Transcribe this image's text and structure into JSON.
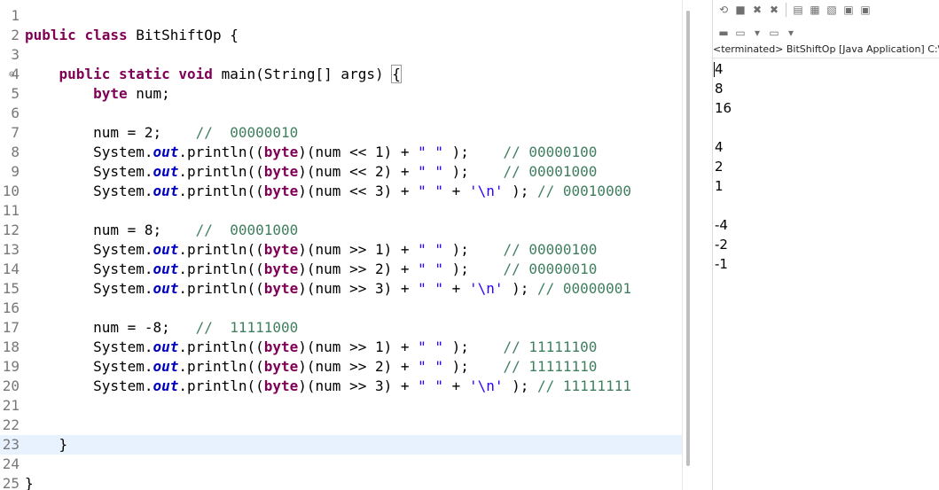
{
  "editor": {
    "lines": [
      {
        "n": "1",
        "code": []
      },
      {
        "n": "2",
        "code": [
          {
            "c": "kw",
            "t": "public"
          },
          {
            "t": " "
          },
          {
            "c": "kw",
            "t": "class"
          },
          {
            "t": " BitShiftOp {"
          }
        ]
      },
      {
        "n": "3",
        "code": []
      },
      {
        "n": "4",
        "fold": "⊖",
        "code": [
          {
            "t": "    "
          },
          {
            "c": "kw",
            "t": "public"
          },
          {
            "t": " "
          },
          {
            "c": "kw",
            "t": "static"
          },
          {
            "t": " "
          },
          {
            "c": "kw",
            "t": "void"
          },
          {
            "t": " main(String[] args) "
          },
          {
            "c": "bracket",
            "t": "{"
          }
        ]
      },
      {
        "n": "5",
        "code": [
          {
            "t": "        "
          },
          {
            "c": "kw",
            "t": "byte"
          },
          {
            "t": " num;"
          }
        ]
      },
      {
        "n": "6",
        "code": []
      },
      {
        "n": "7",
        "code": [
          {
            "t": "        num = 2;    "
          },
          {
            "c": "cm",
            "t": "//  00000010"
          }
        ]
      },
      {
        "n": "8",
        "code": [
          {
            "t": "        System."
          },
          {
            "c": "fld",
            "t": "out"
          },
          {
            "t": ".println(("
          },
          {
            "c": "kw",
            "t": "byte"
          },
          {
            "t": ")(num << 1) + "
          },
          {
            "c": "str",
            "t": "\" \""
          },
          {
            "t": " );    "
          },
          {
            "c": "cm",
            "t": "// 00000100"
          }
        ]
      },
      {
        "n": "9",
        "code": [
          {
            "t": "        System."
          },
          {
            "c": "fld",
            "t": "out"
          },
          {
            "t": ".println(("
          },
          {
            "c": "kw",
            "t": "byte"
          },
          {
            "t": ")(num << 2) + "
          },
          {
            "c": "str",
            "t": "\" \""
          },
          {
            "t": " );    "
          },
          {
            "c": "cm",
            "t": "// 00001000"
          }
        ]
      },
      {
        "n": "10",
        "code": [
          {
            "t": "        System."
          },
          {
            "c": "fld",
            "t": "out"
          },
          {
            "t": ".println(("
          },
          {
            "c": "kw",
            "t": "byte"
          },
          {
            "t": ")(num << 3) + "
          },
          {
            "c": "str",
            "t": "\" \""
          },
          {
            "t": " + "
          },
          {
            "c": "str",
            "t": "'\\n'"
          },
          {
            "t": " ); "
          },
          {
            "c": "cm",
            "t": "// 00010000"
          }
        ]
      },
      {
        "n": "11",
        "code": []
      },
      {
        "n": "12",
        "code": [
          {
            "t": "        num = 8;    "
          },
          {
            "c": "cm",
            "t": "//  00001000"
          }
        ]
      },
      {
        "n": "13",
        "code": [
          {
            "t": "        System."
          },
          {
            "c": "fld",
            "t": "out"
          },
          {
            "t": ".println(("
          },
          {
            "c": "kw",
            "t": "byte"
          },
          {
            "t": ")(num >> 1) + "
          },
          {
            "c": "str",
            "t": "\" \""
          },
          {
            "t": " );    "
          },
          {
            "c": "cm",
            "t": "// 00000100"
          }
        ]
      },
      {
        "n": "14",
        "code": [
          {
            "t": "        System."
          },
          {
            "c": "fld",
            "t": "out"
          },
          {
            "t": ".println(("
          },
          {
            "c": "kw",
            "t": "byte"
          },
          {
            "t": ")(num >> 2) + "
          },
          {
            "c": "str",
            "t": "\" \""
          },
          {
            "t": " );    "
          },
          {
            "c": "cm",
            "t": "// 00000010"
          }
        ]
      },
      {
        "n": "15",
        "code": [
          {
            "t": "        System."
          },
          {
            "c": "fld",
            "t": "out"
          },
          {
            "t": ".println(("
          },
          {
            "c": "kw",
            "t": "byte"
          },
          {
            "t": ")(num >> 3) + "
          },
          {
            "c": "str",
            "t": "\" \""
          },
          {
            "t": " + "
          },
          {
            "c": "str",
            "t": "'\\n'"
          },
          {
            "t": " ); "
          },
          {
            "c": "cm",
            "t": "// 00000001"
          }
        ]
      },
      {
        "n": "16",
        "code": []
      },
      {
        "n": "17",
        "code": [
          {
            "t": "        num = -8;   "
          },
          {
            "c": "cm",
            "t": "//  11111000"
          }
        ]
      },
      {
        "n": "18",
        "code": [
          {
            "t": "        System."
          },
          {
            "c": "fld",
            "t": "out"
          },
          {
            "t": ".println(("
          },
          {
            "c": "kw",
            "t": "byte"
          },
          {
            "t": ")(num >> 1) + "
          },
          {
            "c": "str",
            "t": "\" \""
          },
          {
            "t": " );    "
          },
          {
            "c": "cm",
            "t": "// 11111100"
          }
        ]
      },
      {
        "n": "19",
        "code": [
          {
            "t": "        System."
          },
          {
            "c": "fld",
            "t": "out"
          },
          {
            "t": ".println(("
          },
          {
            "c": "kw",
            "t": "byte"
          },
          {
            "t": ")(num >> 2) + "
          },
          {
            "c": "str",
            "t": "\" \""
          },
          {
            "t": " );    "
          },
          {
            "c": "cm",
            "t": "// 11111110"
          }
        ]
      },
      {
        "n": "20",
        "code": [
          {
            "t": "        System."
          },
          {
            "c": "fld",
            "t": "out"
          },
          {
            "t": ".println(("
          },
          {
            "c": "kw",
            "t": "byte"
          },
          {
            "t": ")(num >> 3) + "
          },
          {
            "c": "str",
            "t": "\" \""
          },
          {
            "t": " + "
          },
          {
            "c": "str",
            "t": "'\\n'"
          },
          {
            "t": " ); "
          },
          {
            "c": "cm",
            "t": "// 11111111"
          }
        ]
      },
      {
        "n": "21",
        "code": []
      },
      {
        "n": "22",
        "code": []
      },
      {
        "n": "23",
        "current": true,
        "code": [
          {
            "t": "    }"
          }
        ]
      },
      {
        "n": "24",
        "code": []
      },
      {
        "n": "25",
        "code": [
          {
            "t": "}"
          }
        ]
      }
    ]
  },
  "console": {
    "title": "<terminated> BitShiftOp [Java Application] C:\\",
    "toolbar_top": [
      {
        "name": "pin-console-icon",
        "glyph": "⟲"
      },
      {
        "name": "stop-icon",
        "glyph": "■"
      },
      {
        "name": "remove-launch-icon",
        "glyph": "✖"
      },
      {
        "name": "remove-all-launches-icon",
        "glyph": "✖"
      },
      {
        "name": "sep"
      },
      {
        "name": "clear-console-icon",
        "glyph": "▤"
      },
      {
        "name": "scroll-lock-icon",
        "glyph": "▦"
      },
      {
        "name": "word-wrap-icon",
        "glyph": "▧"
      },
      {
        "name": "show-on-stdout-icon",
        "glyph": "▣"
      },
      {
        "name": "show-on-stderr-icon",
        "glyph": "▣"
      }
    ],
    "toolbar_bottom": [
      {
        "name": "display-selected-console-icon",
        "glyph": "▬"
      },
      {
        "name": "console-menu-icon",
        "glyph": "▭"
      },
      {
        "name": "dropdown-arrow-icon",
        "glyph": "▾"
      },
      {
        "name": "open-console-icon",
        "glyph": "▭"
      },
      {
        "name": "dropdown-arrow-icon",
        "glyph": "▾"
      }
    ],
    "output": [
      "4",
      "8",
      "16",
      "",
      "4",
      "2",
      "1",
      "",
      "-4",
      "-2",
      "-1"
    ]
  }
}
